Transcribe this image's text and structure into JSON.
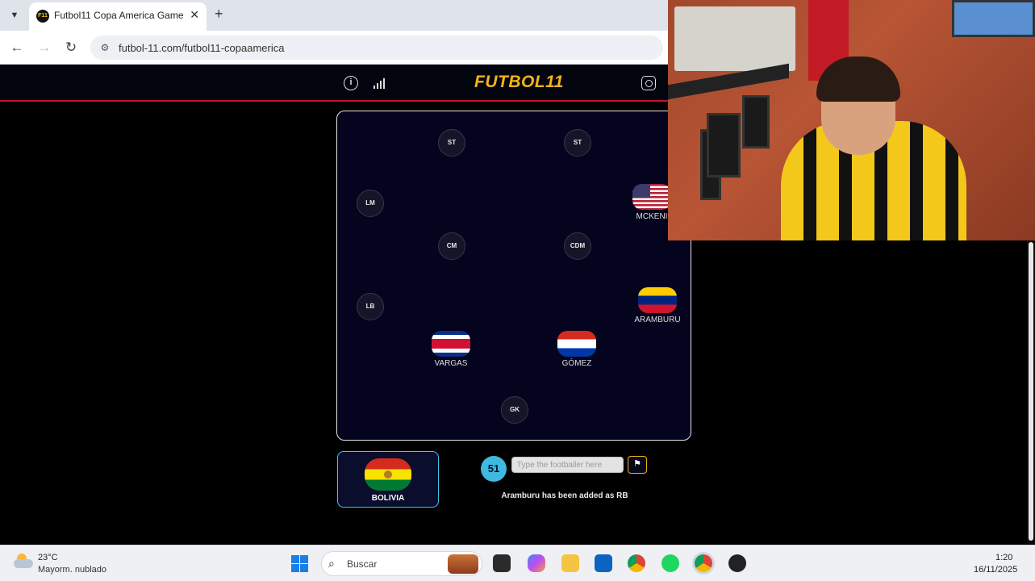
{
  "browser": {
    "tab_title": "Futbol11 Copa America Game",
    "tab_favicon_text": "F11",
    "url": "futbol-11.com/futbol11-copaamerica"
  },
  "site": {
    "logo": "FUTBOL11"
  },
  "pitch": {
    "empty_positions": [
      "ST",
      "ST",
      "LM",
      "CM",
      "CDM",
      "LB",
      "GK"
    ],
    "players": [
      {
        "name": "MCKENI",
        "flag": "usa"
      },
      {
        "name": "ARAMBURU",
        "flag": "venezuela"
      },
      {
        "name": "VARGAS",
        "flag": "costa-rica"
      },
      {
        "name": "GÓMEZ",
        "flag": "paraguay"
      }
    ]
  },
  "team": {
    "name": "BOLIVIA",
    "flag": "bolivia"
  },
  "game": {
    "counter": "51",
    "input_value": "",
    "input_placeholder": "Type the footballer here",
    "status_message": "Aramburu has been added as RB"
  },
  "taskbar": {
    "weather_temp": "23°C",
    "weather_desc": "Mayorm. nublado",
    "search_label": "Buscar",
    "time": "1:20",
    "date": "16/11/2025"
  },
  "colors": {
    "accent": "#f5b41a",
    "header_line": "#c8102e",
    "pitch_bg": "#05041e",
    "counter_bg": "#3fb9e0"
  }
}
